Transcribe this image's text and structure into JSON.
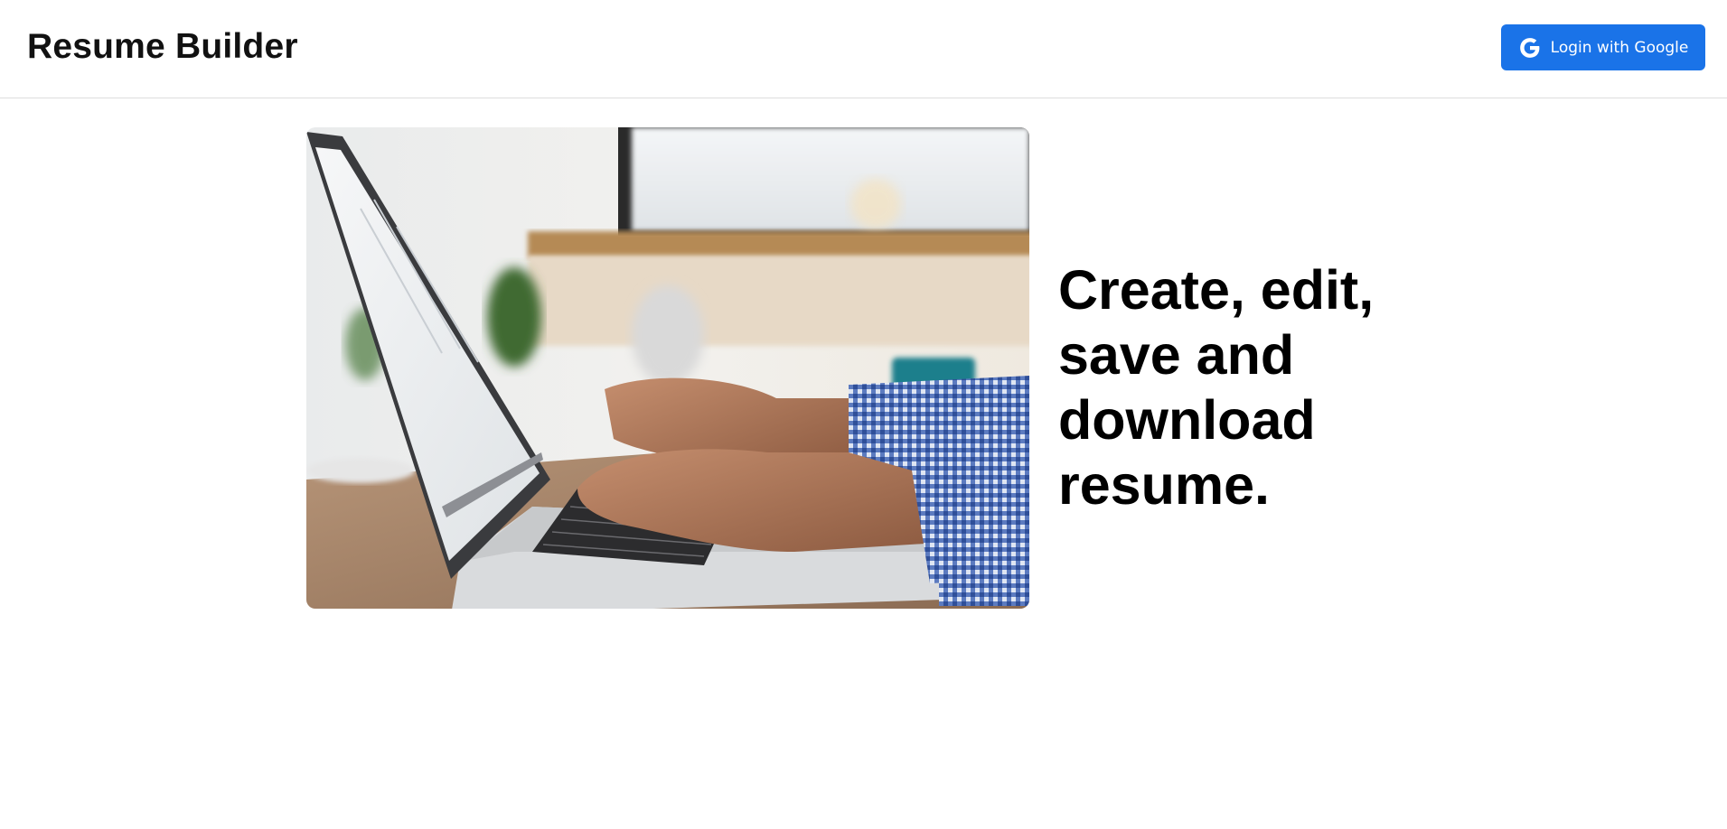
{
  "header": {
    "brand": "Resume Builder",
    "login_label": "Login with Google",
    "login_icon": "google-icon"
  },
  "main": {
    "hero_image_icon": "laptop-typing-photo",
    "headline": "Create, edit, save and download resume."
  },
  "colors": {
    "accent": "#1a73e8",
    "header_border": "#dedede",
    "text": "#000000"
  }
}
